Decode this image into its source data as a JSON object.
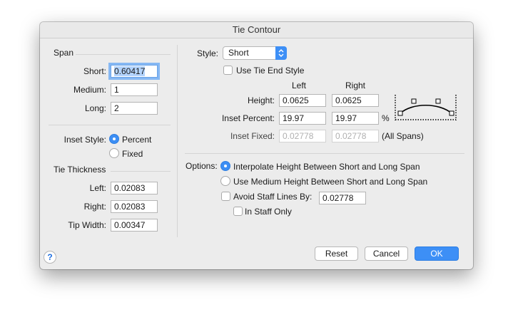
{
  "window": {
    "title": "Tie Contour"
  },
  "span": {
    "heading": "Span",
    "short_label": "Short:",
    "short_value": "0.60417",
    "medium_label": "Medium:",
    "medium_value": "1",
    "long_label": "Long:",
    "long_value": "2"
  },
  "inset_style": {
    "label": "Inset Style:",
    "options": [
      {
        "label": "Percent",
        "selected": true
      },
      {
        "label": "Fixed",
        "selected": false
      }
    ]
  },
  "tie_thickness": {
    "heading": "Tie Thickness",
    "left_label": "Left:",
    "left_value": "0.02083",
    "right_label": "Right:",
    "right_value": "0.02083",
    "tip_label": "Tip Width:",
    "tip_value": "0.00347"
  },
  "style": {
    "label": "Style:",
    "selected": "Short",
    "use_tie_end_label": "Use Tie End Style",
    "use_tie_end_checked": false
  },
  "columns": {
    "left": "Left",
    "right": "Right"
  },
  "height": {
    "label": "Height:",
    "left": "0.0625",
    "right": "0.0625"
  },
  "inset_percent": {
    "label": "Inset Percent:",
    "left": "19.97",
    "right": "19.97",
    "unit": "%"
  },
  "inset_fixed": {
    "label": "Inset Fixed:",
    "left": "0.02778",
    "right": "0.02778",
    "note": "(All Spans)"
  },
  "options": {
    "label": "Options:",
    "interpolate_label": "Interpolate Height Between Short and Long Span",
    "interpolate_selected": true,
    "medium_label": "Use Medium Height Between Short and Long Span",
    "medium_selected": false,
    "avoid_label": "Avoid Staff Lines By:",
    "avoid_checked": true,
    "avoid_value": "0.02778",
    "in_staff_label": "In Staff Only",
    "in_staff_checked": true
  },
  "buttons": {
    "help": "?",
    "reset": "Reset",
    "cancel": "Cancel",
    "ok": "OK"
  },
  "icons": {
    "help": "question-mark-icon",
    "popup_arrows": "chevron-updown-icon",
    "preview": "tie-curve-preview-icon"
  },
  "colors": {
    "accent": "#3d8ff6",
    "panel": "#ececec"
  }
}
